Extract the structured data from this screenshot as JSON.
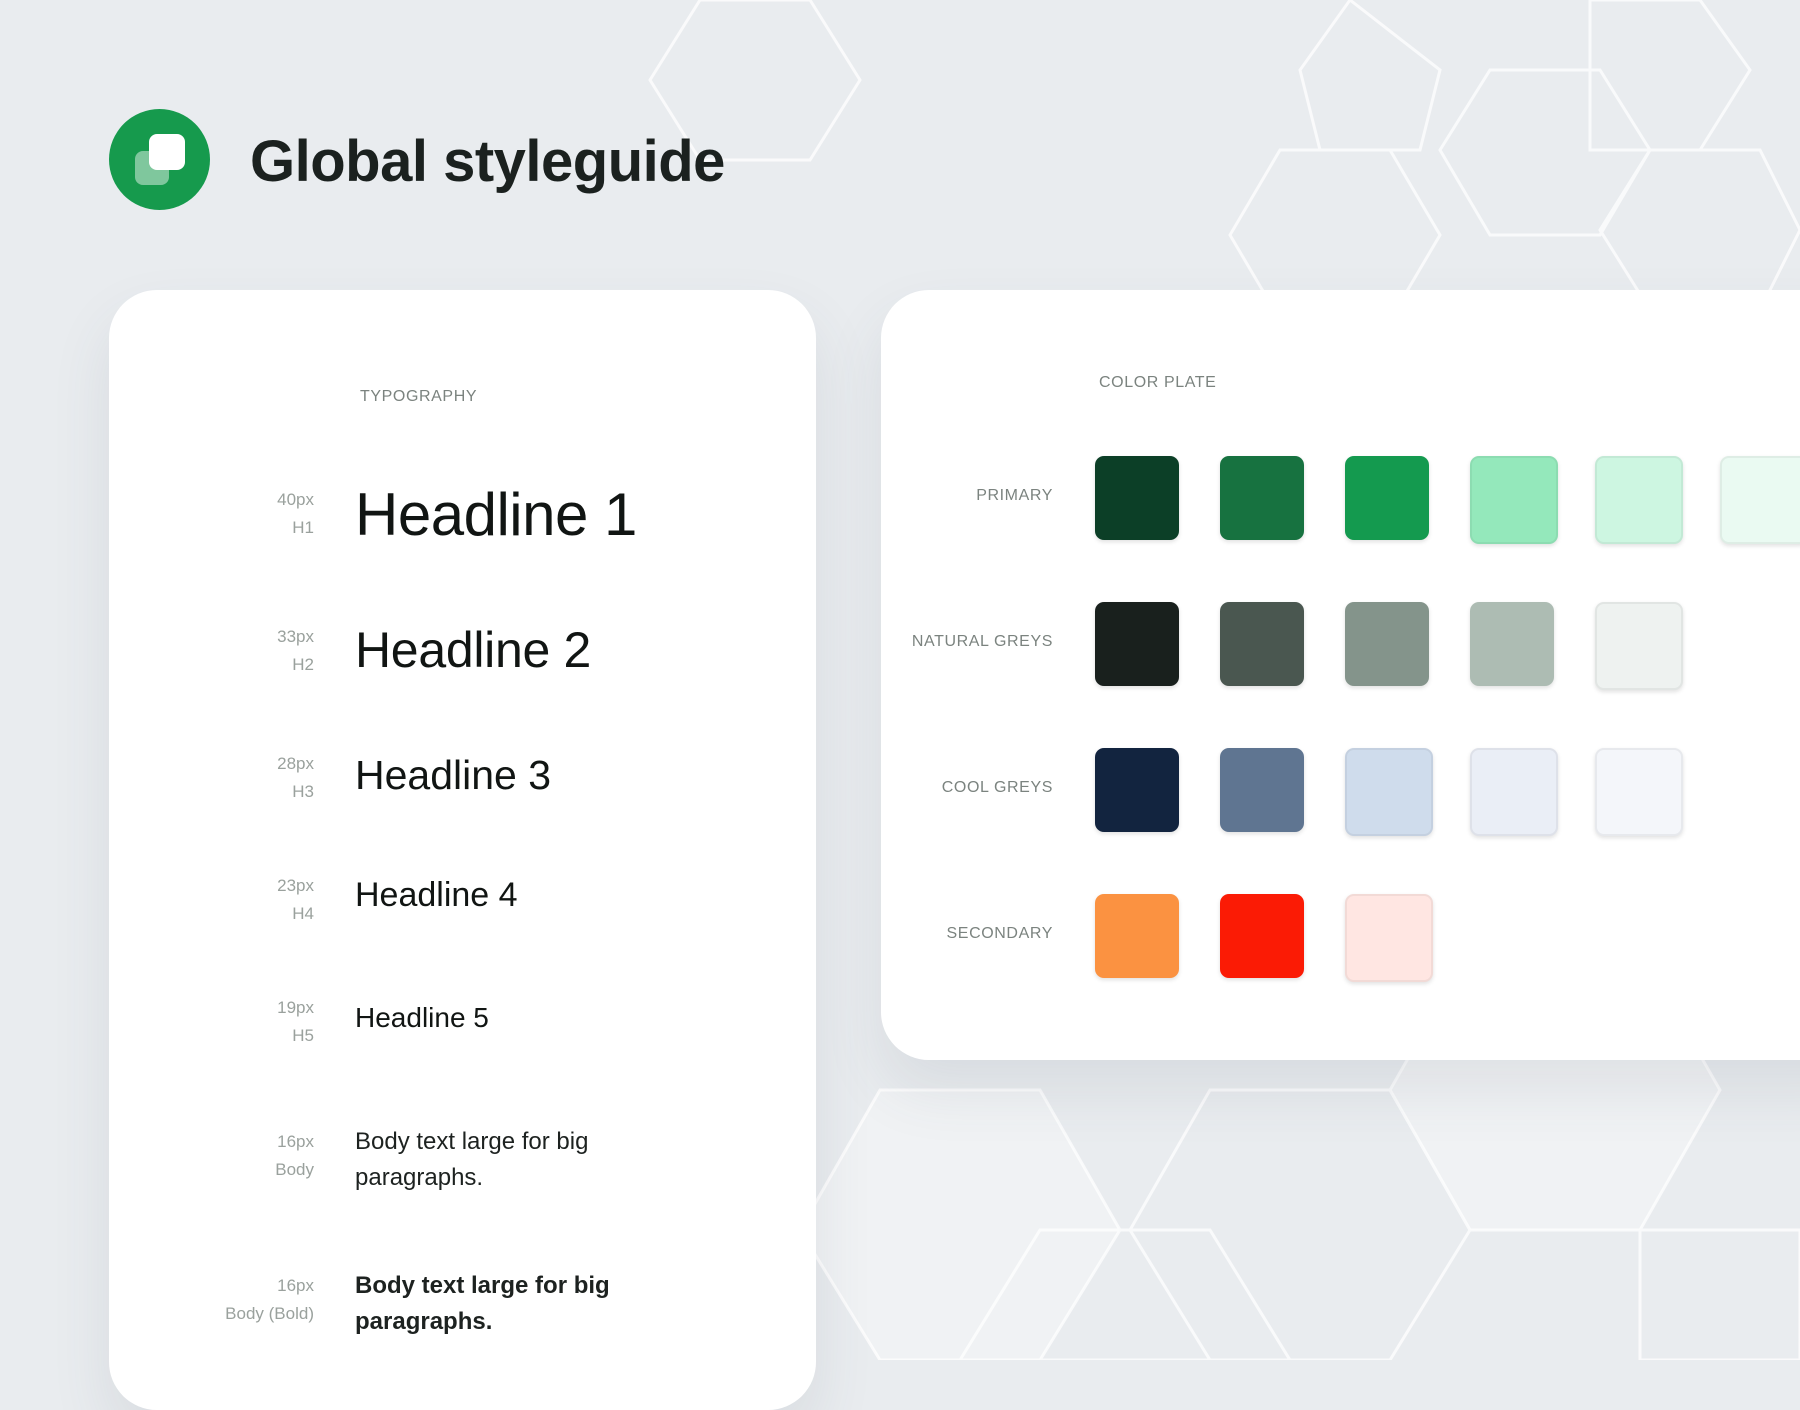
{
  "header": {
    "title": "Global styleguide"
  },
  "typography": {
    "label": "TYPOGRAPHY",
    "rows": [
      {
        "size": "40px",
        "tag": "H1",
        "sample": "Headline 1"
      },
      {
        "size": "33px",
        "tag": "H2",
        "sample": "Headline 2"
      },
      {
        "size": "28px",
        "tag": "H3",
        "sample": "Headline 3"
      },
      {
        "size": "23px",
        "tag": "H4",
        "sample": "Headline 4"
      },
      {
        "size": "19px",
        "tag": "H5",
        "sample": "Headline 5"
      },
      {
        "size": "16px",
        "tag": "Body",
        "sample": "Body text large for big paragraphs."
      },
      {
        "size": "16px",
        "tag": "Body (Bold)",
        "sample": "Body text large for big paragraphs."
      }
    ]
  },
  "color_plate": {
    "label": "COLOR PLATE",
    "rows": [
      {
        "name": "PRIMARY",
        "swatches": [
          "#0c3f27",
          "#177240",
          "#149a4f",
          "#94e8bb",
          "#cdf6e1",
          "#eafaf2"
        ]
      },
      {
        "name": "NATURAL GREYS",
        "swatches": [
          "#19201d",
          "#4a5750",
          "#84948b",
          "#adbcb3",
          "#eef2f0"
        ]
      },
      {
        "name": "COOL GREYS",
        "swatches": [
          "#12243f",
          "#5f7591",
          "#cfdcec",
          "#eaeef6",
          "#f4f6fa"
        ]
      },
      {
        "name": "SECONDARY",
        "swatches": [
          "#fb9241",
          "#fb1b05",
          "#ffe6e2"
        ]
      }
    ]
  },
  "icons": {
    "logo": "stacked-squares-logo-icon"
  },
  "colors": {
    "brand": "#169a4d",
    "title": "#1b211f"
  }
}
